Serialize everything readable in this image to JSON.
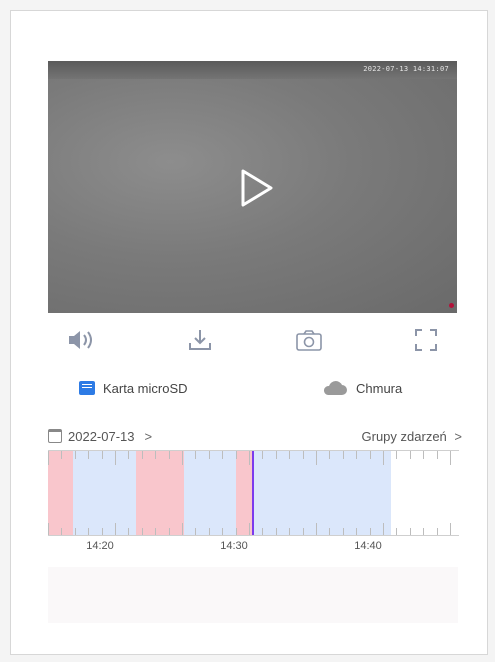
{
  "player": {
    "timestamp_osd": "2022-07-13  14:31:07",
    "play_icon": "play-icon",
    "recording_indicator_color": "#b3123a"
  },
  "controls": [
    {
      "icon": "volume-icon",
      "label": "volume"
    },
    {
      "icon": "download-icon",
      "label": "download"
    },
    {
      "icon": "camera-icon",
      "label": "snapshot"
    },
    {
      "icon": "fullscreen-icon",
      "label": "fullscreen"
    }
  ],
  "storage": {
    "sd_label": "Karta microSD",
    "cloud_label": "Chmura"
  },
  "date_bar": {
    "date": "2022-07-13",
    "events_label": "Grupy zdarzeń"
  },
  "timeline": {
    "labels": [
      "14:20",
      "14:30",
      "14:40"
    ],
    "colors": {
      "alarm": "#f9c6cc",
      "recorded": "#dbe7fb",
      "cursor": "#7c3aed"
    }
  }
}
